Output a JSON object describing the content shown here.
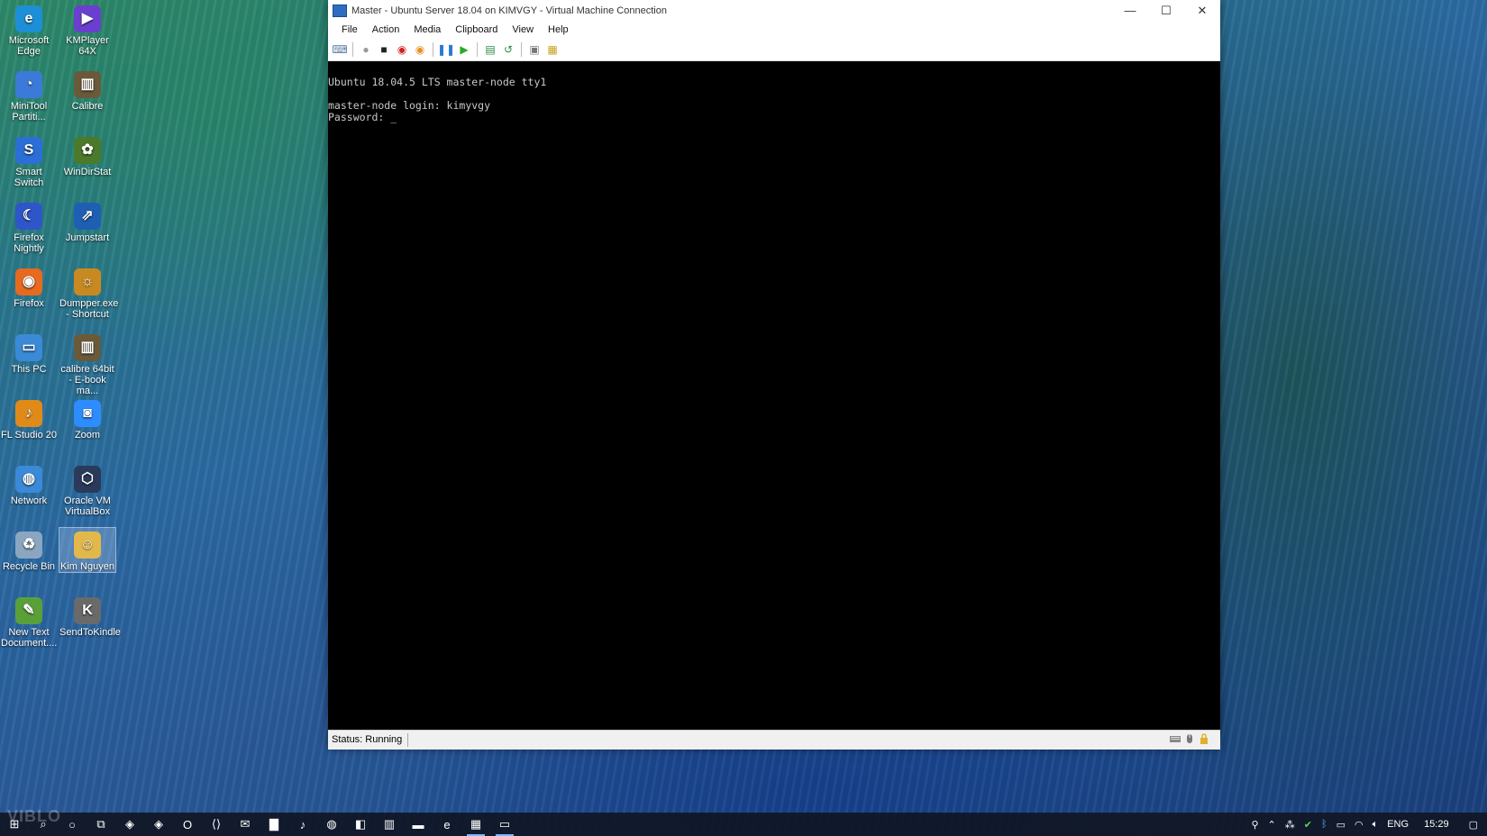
{
  "desktop": {
    "icons": [
      {
        "label": "Microsoft Edge",
        "icon": "edge-icon",
        "color": "#1c8fd6",
        "glyph": "e"
      },
      {
        "label": "KMPlayer 64X",
        "icon": "kmplayer-icon",
        "color": "#6a3fd0",
        "glyph": "▶"
      },
      {
        "label": "MiniTool Partiti...",
        "icon": "minitool-icon",
        "color": "#3b7ad8",
        "glyph": "◔"
      },
      {
        "label": "Calibre",
        "icon": "calibre-icon",
        "color": "#6b5a3a",
        "glyph": "▥"
      },
      {
        "label": "Smart Switch",
        "icon": "smart-switch-icon",
        "color": "#2b6fd6",
        "glyph": "S"
      },
      {
        "label": "WinDirStat",
        "icon": "windirstat-icon",
        "color": "#4a7a2a",
        "glyph": "✿"
      },
      {
        "label": "Firefox Nightly",
        "icon": "firefox-nightly-icon",
        "color": "#2f56c8",
        "glyph": "☾"
      },
      {
        "label": "Jumpstart",
        "icon": "jumpstart-icon",
        "color": "#1e5fb4",
        "glyph": "⇗"
      },
      {
        "label": "Firefox",
        "icon": "firefox-icon",
        "color": "#e66a1f",
        "glyph": "◉"
      },
      {
        "label": "Dumpper.exe - Shortcut",
        "icon": "dumpper-icon",
        "color": "#c88a20",
        "glyph": "☼"
      },
      {
        "label": "This PC",
        "icon": "this-pc-icon",
        "color": "#3a8ad8",
        "glyph": "▭"
      },
      {
        "label": "calibre 64bit - E-book ma...",
        "icon": "calibre64-icon",
        "color": "#6b5a3a",
        "glyph": "▥"
      },
      {
        "label": "FL Studio 20",
        "icon": "fl-studio-icon",
        "color": "#e08a1a",
        "glyph": "♪"
      },
      {
        "label": "Zoom",
        "icon": "zoom-icon",
        "color": "#2d8cff",
        "glyph": "◙"
      },
      {
        "label": "Network",
        "icon": "network-icon",
        "color": "#3a8ad8",
        "glyph": "◍"
      },
      {
        "label": "Oracle VM VirtualBox",
        "icon": "virtualbox-icon",
        "color": "#2a3a5a",
        "glyph": "⬡"
      },
      {
        "label": "Recycle Bin",
        "icon": "recycle-bin-icon",
        "color": "#8aa6c0",
        "glyph": "♻"
      },
      {
        "label": "Kim Nguyen",
        "icon": "user-folder-icon",
        "color": "#e2b84a",
        "glyph": "☺"
      },
      {
        "label": "New Text Document....",
        "icon": "text-document-icon",
        "color": "#5aa03a",
        "glyph": "✎"
      },
      {
        "label": "SendToKindle",
        "icon": "kindle-icon",
        "color": "#6a6a6a",
        "glyph": "K"
      }
    ]
  },
  "window": {
    "title": "Master - Ubuntu Server 18.04 on KIMVGY - Virtual Machine Connection",
    "menu": [
      "File",
      "Action",
      "Media",
      "Clipboard",
      "View",
      "Help"
    ],
    "toolbar": [
      {
        "name": "ctrl-alt-del-icon",
        "glyph": "⌨",
        "color": "#5a7aa8"
      },
      {
        "name": "start-icon",
        "glyph": "●",
        "color": "#999"
      },
      {
        "name": "turn-off-icon",
        "glyph": "■",
        "color": "#222"
      },
      {
        "name": "shut-down-icon",
        "glyph": "◉",
        "color": "#d02020"
      },
      {
        "name": "save-icon",
        "glyph": "◉",
        "color": "#e89020"
      },
      {
        "name": "pause-icon",
        "glyph": "❚❚",
        "color": "#2a7ad8"
      },
      {
        "name": "resume-icon",
        "glyph": "▶",
        "color": "#2aa82a"
      },
      {
        "name": "checkpoint-icon",
        "glyph": "▤",
        "color": "#2a8a4a"
      },
      {
        "name": "revert-icon",
        "glyph": "↺",
        "color": "#2a8a4a"
      },
      {
        "name": "enhanced-session-icon",
        "glyph": "▣",
        "color": "#777"
      },
      {
        "name": "share-icon",
        "glyph": "▦",
        "color": "#c8a020"
      }
    ],
    "console_lines": [
      "Ubuntu 18.04.5 LTS master-node tty1",
      "",
      "master-node login: kimyvgy",
      "Password: _"
    ],
    "status": "Status: Running"
  },
  "taskbar": {
    "apps": [
      {
        "name": "start-icon",
        "glyph": "⊞"
      },
      {
        "name": "search-icon",
        "glyph": "⌕"
      },
      {
        "name": "cortana-icon",
        "glyph": "○"
      },
      {
        "name": "task-view-icon",
        "glyph": "⧉"
      },
      {
        "name": "brave-icon",
        "glyph": "◈"
      },
      {
        "name": "brave-beta-icon",
        "glyph": "◈"
      },
      {
        "name": "opera-icon",
        "glyph": "O"
      },
      {
        "name": "vscode-icon",
        "glyph": "⟨⟩"
      },
      {
        "name": "mail-icon",
        "glyph": "✉"
      },
      {
        "name": "sticky-notes-icon",
        "glyph": "▇"
      },
      {
        "name": "fl-studio-icon",
        "glyph": "♪"
      },
      {
        "name": "spotify-icon",
        "glyph": "◍"
      },
      {
        "name": "office-icon",
        "glyph": "◧"
      },
      {
        "name": "calibre-icon",
        "glyph": "▥"
      },
      {
        "name": "file-explorer-icon",
        "glyph": "▬"
      },
      {
        "name": "edge-icon",
        "glyph": "e"
      },
      {
        "name": "hyperv-manager-icon",
        "glyph": "▦"
      },
      {
        "name": "vm-connection-icon",
        "glyph": "▭"
      }
    ],
    "tray": {
      "language": "ENG",
      "time": "15:29"
    }
  },
  "watermark": "VIBLO"
}
